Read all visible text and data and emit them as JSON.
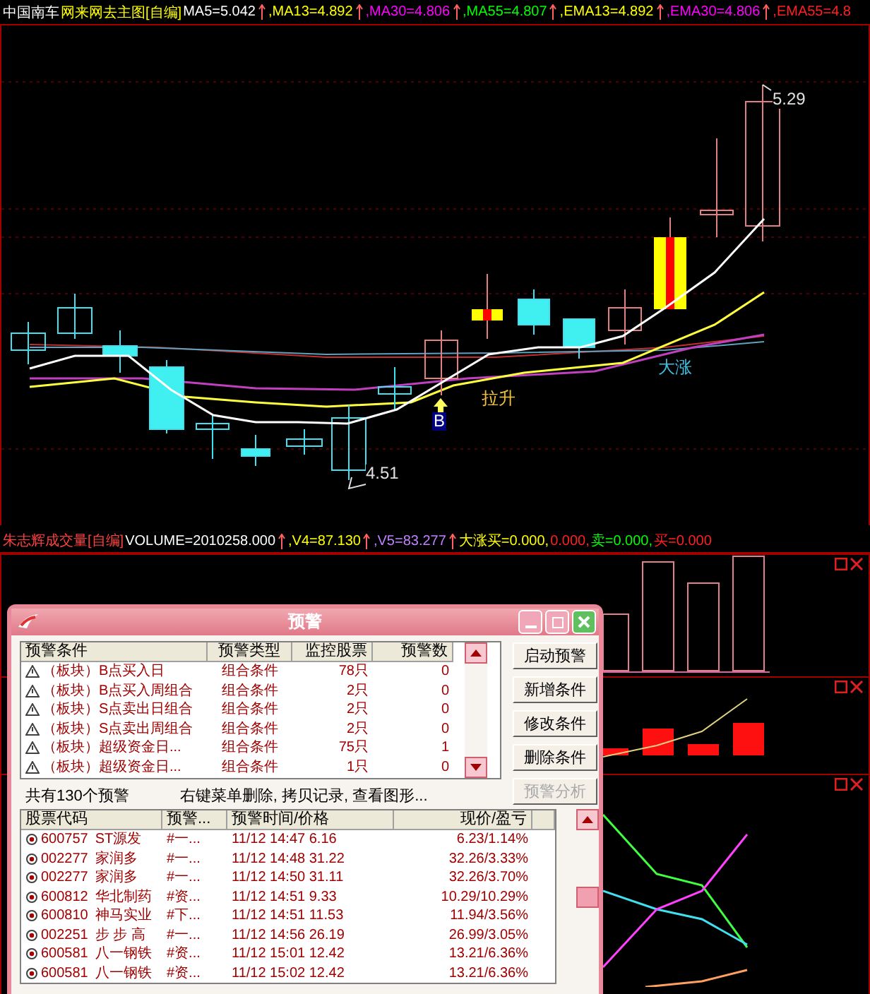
{
  "main_legend": {
    "stock": "中国南车",
    "formula": "网来网去主图[自编]",
    "items": [
      {
        "text": "MA5=5.042",
        "color": "#ffffff"
      },
      {
        "text": ",MA13=4.892",
        "color": "#ffff00"
      },
      {
        "text": ",MA30=4.806",
        "color": "#ff00ff"
      },
      {
        "text": ",MA55=4.807",
        "color": "#00ff00"
      },
      {
        "text": ",EMA13=4.892",
        "color": "#ffff00"
      },
      {
        "text": ",EMA30=4.806",
        "color": "#ff00ff"
      },
      {
        "text": ",EMA55=4.8",
        "color": "#ff2020"
      }
    ]
  },
  "main_chart": {
    "high_label": "5.29",
    "low_label": "4.51",
    "buy_marker": "B",
    "rise_label": "拉升",
    "surge_label": "大涨"
  },
  "volume_legend": {
    "formula": "朱志辉成交量[自编]",
    "items": [
      {
        "text": "VOLUME=2010258.000",
        "color": "#ffffff",
        "arrow": true
      },
      {
        "text": ",V4=87.130",
        "color": "#ffff00",
        "arrow": true
      },
      {
        "text": ",V5=83.277",
        "color": "#c080ff",
        "arrow": true
      },
      {
        "text": "大涨买=0.000,",
        "color": "#ffff00",
        "arrow": false
      },
      {
        "text": "0.000,",
        "color": "#ff2020",
        "arrow": false
      },
      {
        "text": "卖=0.000,",
        "color": "#00ff00",
        "arrow": false
      },
      {
        "text": "买=0.000",
        "color": "#ff2020",
        "arrow": false
      }
    ]
  },
  "dialog": {
    "title": "预警",
    "alerts": {
      "columns": [
        "预警条件",
        "预警类型",
        "监控股票",
        "预警数"
      ],
      "rows": [
        {
          "condition": "（板块）B点买入日",
          "type": "组合条件",
          "stocks": "78只",
          "count": "0"
        },
        {
          "condition": "（板块）B点买入周组合",
          "type": "组合条件",
          "stocks": "2只",
          "count": "0"
        },
        {
          "condition": "（板块）S点卖出日组合",
          "type": "组合条件",
          "stocks": "2只",
          "count": "0"
        },
        {
          "condition": "（板块）S点卖出周组合",
          "type": "组合条件",
          "stocks": "2只",
          "count": "0"
        },
        {
          "condition": "（板块）超级资金日...",
          "type": "组合条件",
          "stocks": "75只",
          "count": "1"
        },
        {
          "condition": "（板块）超级资金日...",
          "type": "组合条件",
          "stocks": "1只",
          "count": "0"
        }
      ]
    },
    "buttons": [
      {
        "label": "启动预警",
        "disabled": false
      },
      {
        "label": "新增条件",
        "disabled": false
      },
      {
        "label": "修改条件",
        "disabled": false
      },
      {
        "label": "删除条件",
        "disabled": false
      },
      {
        "label": "预警分析",
        "disabled": true
      }
    ],
    "total": "共有130个预警",
    "hint": "右键菜单删除, 拷贝记录, 查看图形...",
    "hits": {
      "columns": [
        "股票代码",
        "预警...",
        "预警时间/价格",
        "现价/盈亏"
      ],
      "rows": [
        {
          "code": "600757",
          "name": "ST源发",
          "alert": "#一...",
          "time": "11/12 14:47 6.16",
          "result": "6.23/1.14%"
        },
        {
          "code": "002277",
          "name": "家润多",
          "alert": "#一...",
          "time": "11/12 14:48 31.22",
          "result": "32.26/3.33%"
        },
        {
          "code": "002277",
          "name": "家润多",
          "alert": "#一...",
          "time": "11/12 14:50 31.11",
          "result": "32.26/3.70%"
        },
        {
          "code": "600812",
          "name": "华北制药",
          "alert": "#资...",
          "time": "11/12 14:51 9.33",
          "result": "10.29/10.29%"
        },
        {
          "code": "600810",
          "name": "神马实业",
          "alert": "#下...",
          "time": "11/12 14:51 11.53",
          "result": "11.94/3.56%"
        },
        {
          "code": "002251",
          "name": "步 步 高",
          "alert": "#一...",
          "time": "11/12 14:56 26.19",
          "result": "26.99/3.05%"
        },
        {
          "code": "600581",
          "name": "八一钢铁",
          "alert": "#资...",
          "time": "11/12 15:01 12.42",
          "result": "13.21/6.36%"
        },
        {
          "code": "600581",
          "name": "八一钢铁",
          "alert": "#资...",
          "time": "11/12 15:02 12.42",
          "result": "13.21/6.36%"
        }
      ]
    }
  }
}
